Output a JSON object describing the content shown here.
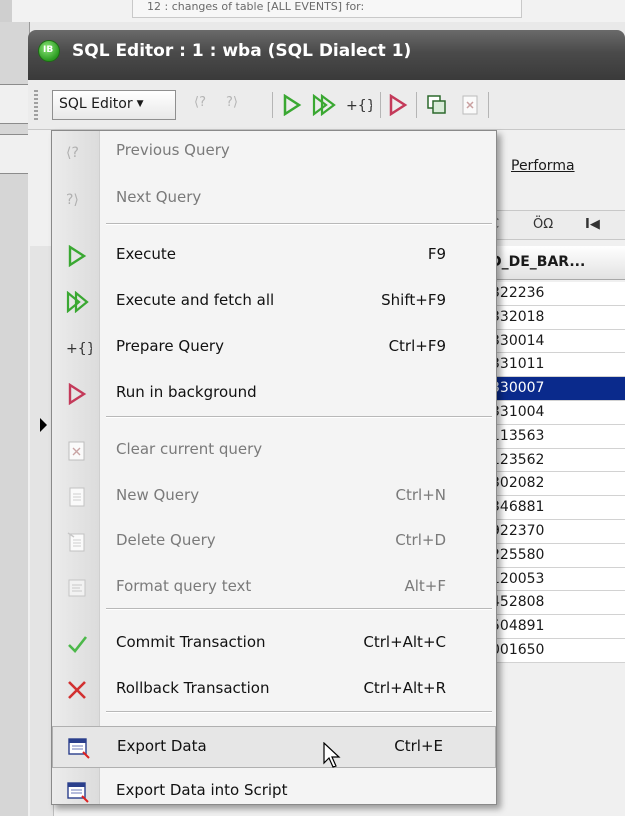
{
  "top_strip": {
    "text": "12 : changes of table [ALL EVENTS] for:"
  },
  "window": {
    "title": "SQL Editor : 1 : wba (SQL Dialect 1)",
    "icon_label": "IB"
  },
  "toolbar": {
    "sql_editor_label": "SQL Editor",
    "prev_glyph": "⟨?",
    "next_glyph": "?⟩"
  },
  "background": {
    "tab_label": "Performa",
    "grid_toolbar": {
      "c_label": "C",
      "omega_label": "ÖΩ",
      "first_label": "I◀"
    },
    "column_header": "D_DE_BAR...",
    "rows": [
      "322236",
      "332018",
      "330014",
      "331011",
      "330007",
      "331004",
      "113563",
      "123562",
      "302082",
      "346881",
      "922370",
      "225580",
      "120053",
      "452808",
      "504891",
      "001650"
    ],
    "selected_row_index": 4
  },
  "menu": {
    "items": [
      {
        "label": "Previous Query",
        "shortcut": "",
        "icon": "previous-query-icon",
        "disabled": true
      },
      {
        "label": "Next Query",
        "shortcut": "",
        "icon": "next-query-icon",
        "disabled": true
      },
      {
        "label": "Execute",
        "shortcut": "F9",
        "icon": "execute-icon",
        "disabled": false
      },
      {
        "label": "Execute and fetch all",
        "shortcut": "Shift+F9",
        "icon": "execute-fetch-all-icon",
        "disabled": false
      },
      {
        "label": "Prepare Query",
        "shortcut": "Ctrl+F9",
        "icon": "prepare-query-icon",
        "disabled": false
      },
      {
        "label": "Run in background",
        "shortcut": "",
        "icon": "run-background-icon",
        "disabled": false
      },
      {
        "label": "Clear current query",
        "shortcut": "",
        "icon": "clear-query-icon",
        "disabled": true
      },
      {
        "label": "New Query",
        "shortcut": "Ctrl+N",
        "icon": "new-query-icon",
        "disabled": true
      },
      {
        "label": "Delete Query",
        "shortcut": "Ctrl+D",
        "icon": "delete-query-icon",
        "disabled": true
      },
      {
        "label": "Format query text",
        "shortcut": "Alt+F",
        "icon": "format-query-icon",
        "disabled": true
      },
      {
        "label": "Commit Transaction",
        "shortcut": "Ctrl+Alt+C",
        "icon": "commit-check-icon",
        "disabled": false
      },
      {
        "label": "Rollback Transaction",
        "shortcut": "Ctrl+Alt+R",
        "icon": "rollback-x-icon",
        "disabled": false
      },
      {
        "label": "Export Data",
        "shortcut": "Ctrl+E",
        "icon": "export-data-icon",
        "disabled": false,
        "highlighted": true
      },
      {
        "label": "Export Data into Script",
        "shortcut": "",
        "icon": "export-script-icon",
        "disabled": false
      }
    ]
  },
  "colors": {
    "execute_green": "#3aa832",
    "background_red": "#c43a5a",
    "commit_green": "#4cb84a",
    "rollback_red": "#d23030",
    "selection_blue": "#0a2a8c"
  }
}
